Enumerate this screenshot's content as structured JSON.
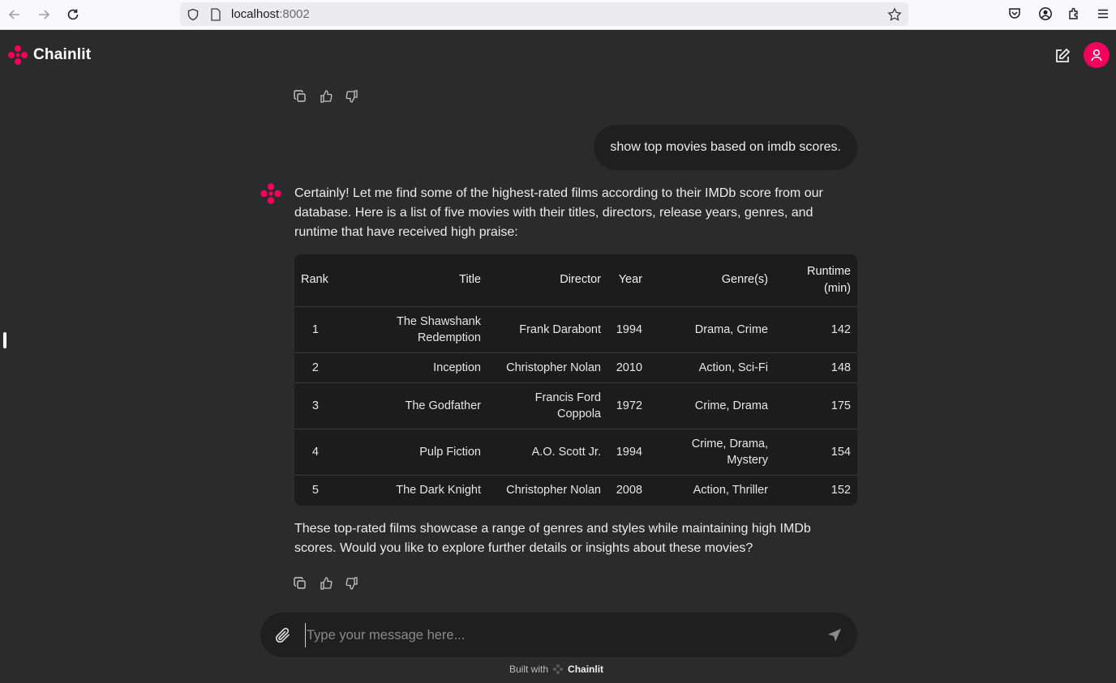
{
  "browser": {
    "url_host": "localhost",
    "url_port": ":8002"
  },
  "app": {
    "brand": "Chainlit",
    "accent": "#f2005c"
  },
  "conversation": {
    "user_message": "show top movies based on imdb scores.",
    "assistant_intro": "Certainly! Let me find some of the highest-rated films according to their IMDb score from our database. Here is a list of five movies with their titles, directors, release years, genres, and runtime that have received high praise:",
    "table": {
      "headers": [
        "Rank",
        "Title",
        "Director",
        "Year",
        "Genre(s)",
        "Runtime (min)"
      ],
      "rows": [
        [
          "1",
          "The Shawshank Redemption",
          "Frank Darabont",
          "1994",
          "Drama, Crime",
          "142"
        ],
        [
          "2",
          "Inception",
          "Christopher Nolan",
          "2010",
          "Action, Sci-Fi",
          "148"
        ],
        [
          "3",
          "The Godfather",
          "Francis Ford Coppola",
          "1972",
          "Crime, Drama",
          "175"
        ],
        [
          "4",
          "Pulp Fiction",
          "A.O. Scott Jr.",
          "1994",
          "Crime, Drama, Mystery",
          "154"
        ],
        [
          "5",
          "The Dark Knight",
          "Christopher Nolan",
          "2008",
          "Action, Thriller",
          "152"
        ]
      ]
    },
    "assistant_outro": "These top-rated films showcase a range of genres and styles while maintaining high IMDb scores. Would you like to explore further details or insights about these movies?"
  },
  "composer": {
    "placeholder": "Type your message here..."
  },
  "footer": {
    "built_with": "Built with",
    "brand": "Chainlit"
  }
}
